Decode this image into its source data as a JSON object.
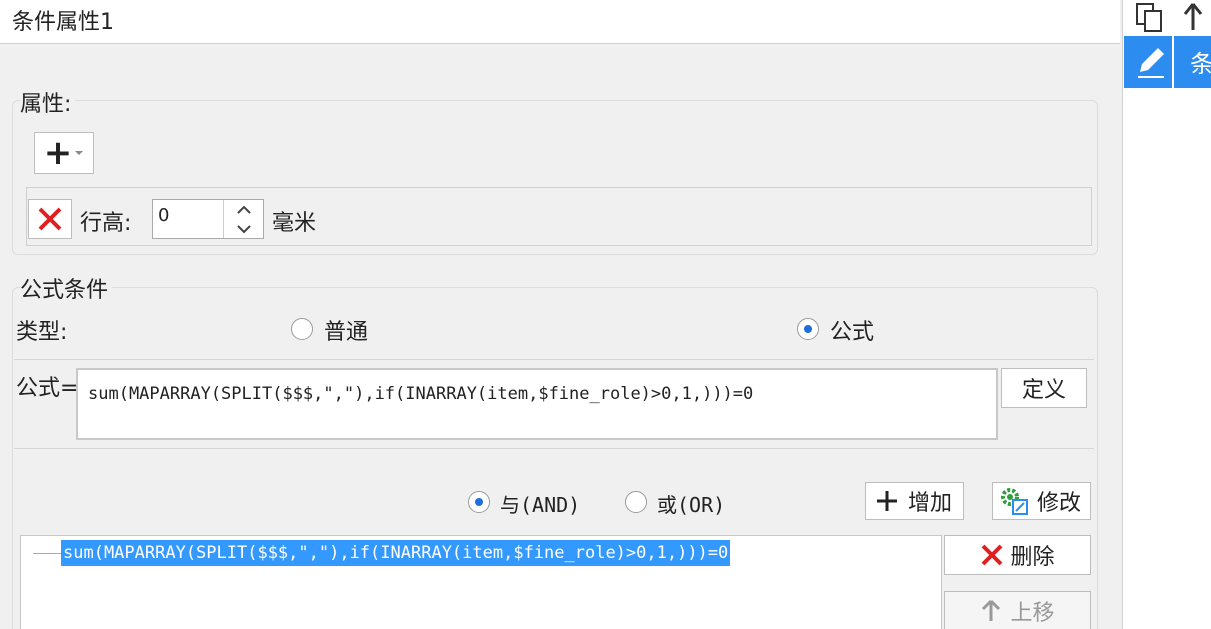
{
  "window": {
    "title": "条件属性1"
  },
  "attributes": {
    "legend": "属性:",
    "add_symbol": "+",
    "row_height_label": "行高:",
    "row_height_value": "0",
    "unit": "毫米"
  },
  "formula_condition": {
    "legend": "公式条件",
    "type_label": "类型:",
    "type_options": [
      "普通",
      "公式"
    ],
    "selected_type": "公式",
    "formula_label": "公式=",
    "formula_value": "sum(MAPARRAY(SPLIT($$$,\",\"),if(INARRAY(item,$fine_role)>0,1,)))=0",
    "define_button": "定义",
    "logic_and": "与(AND)",
    "logic_or": "或(OR)",
    "add_button": "增加",
    "modify_button": "修改",
    "delete_button": "删除",
    "move_up_button": "上移",
    "conditions": [
      "sum(MAPARRAY(SPLIT($$$,\",\"),if(INARRAY(item,$fine_role)>0,1,)))=0"
    ]
  },
  "right_panel": {
    "tab_label": "条"
  },
  "colors": {
    "accent": "#2d8cf0",
    "selection": "#3399ff",
    "delete_red": "#e02020",
    "modify_green": "#2e9e3a"
  }
}
